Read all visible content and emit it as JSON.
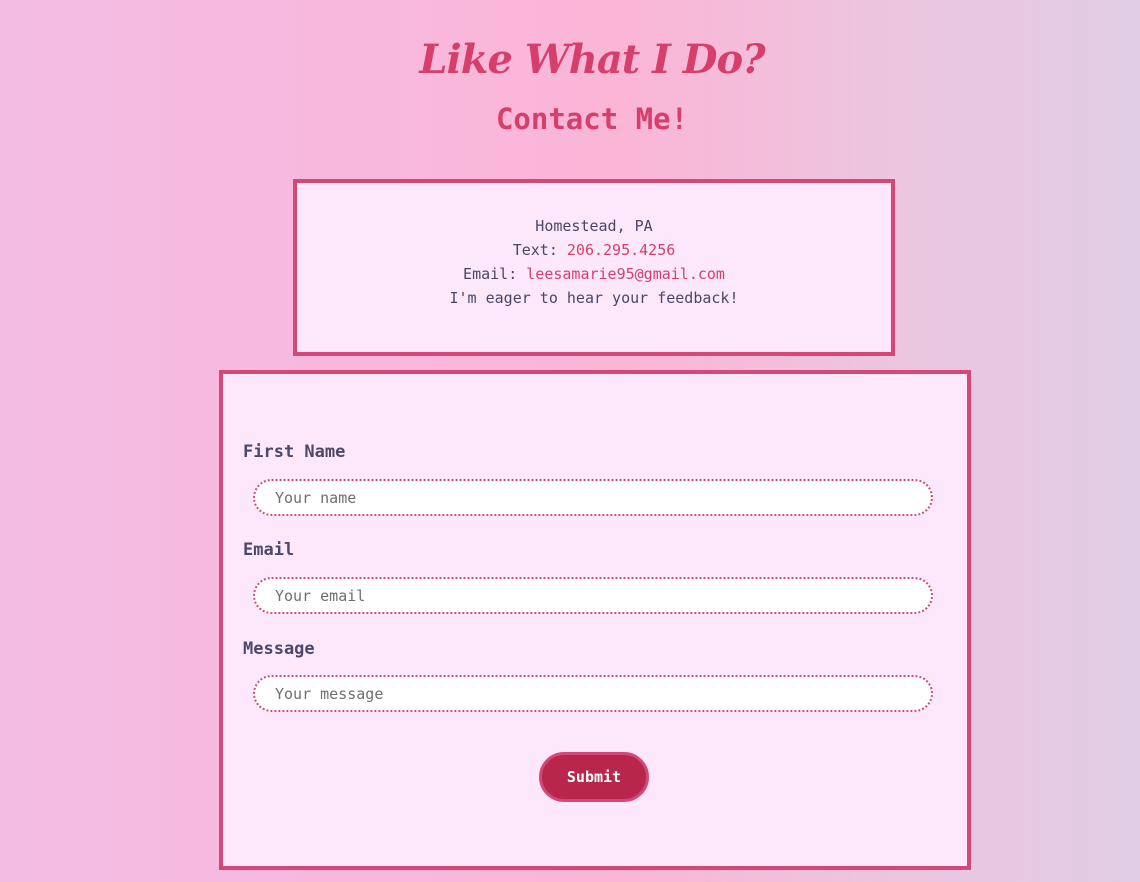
{
  "header": {
    "title": "Like What I Do?",
    "subtitle": "Contact Me!"
  },
  "contact_info": {
    "location": "Homestead, PA",
    "text_label": "Text: ",
    "phone": "206.295.4256",
    "email_label": "Email: ",
    "email": "leesamarie95@gmail.com",
    "message": "I'm eager to hear your feedback!"
  },
  "form": {
    "first_name": {
      "label": "First Name",
      "placeholder": "Your name",
      "value": ""
    },
    "email": {
      "label": "Email",
      "placeholder": "Your email",
      "value": ""
    },
    "message": {
      "label": "Message",
      "placeholder": "Your message",
      "value": ""
    },
    "submit_label": "Submit"
  },
  "colors": {
    "accent": "#d63f6c",
    "border": "#d44877",
    "button": "#b8274b",
    "panel_bg": "#fde8fb",
    "text": "#4b4666"
  }
}
